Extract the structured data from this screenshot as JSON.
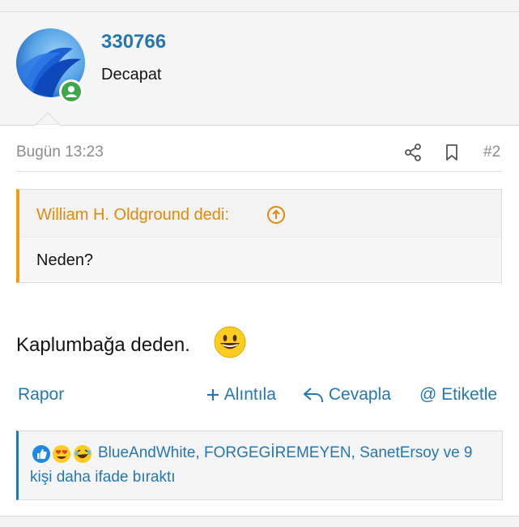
{
  "user": {
    "name": "330766",
    "title": "Decapat",
    "online_color": "#3fa64b"
  },
  "post": {
    "date": "Bugün 13:23",
    "number": "#2",
    "icons": {
      "share": "share-icon",
      "bookmark": "bookmark-icon"
    },
    "quote": {
      "author": "William H. Oldground dedi:",
      "text": "Neden?"
    },
    "body": "Kaplumbağa deden.",
    "emoji": "grinning-face-emoji"
  },
  "actions": {
    "report": "Rapor",
    "quote": "Alıntıla",
    "reply": "Cevapla",
    "tag": "Etiketle"
  },
  "reactions": {
    "icons": [
      "like-icon",
      "heart-eyes-icon",
      "laughing-icon"
    ],
    "users": "BlueAndWhite, FORGEGİREMEYEN, SanetErsoy",
    "connector": " ve 9",
    "rest": "kişi daha ifade bıraktı"
  },
  "colors": {
    "accent": "#2577b1",
    "quote_accent": "#f39c12",
    "muted": "#8c8c8c"
  }
}
